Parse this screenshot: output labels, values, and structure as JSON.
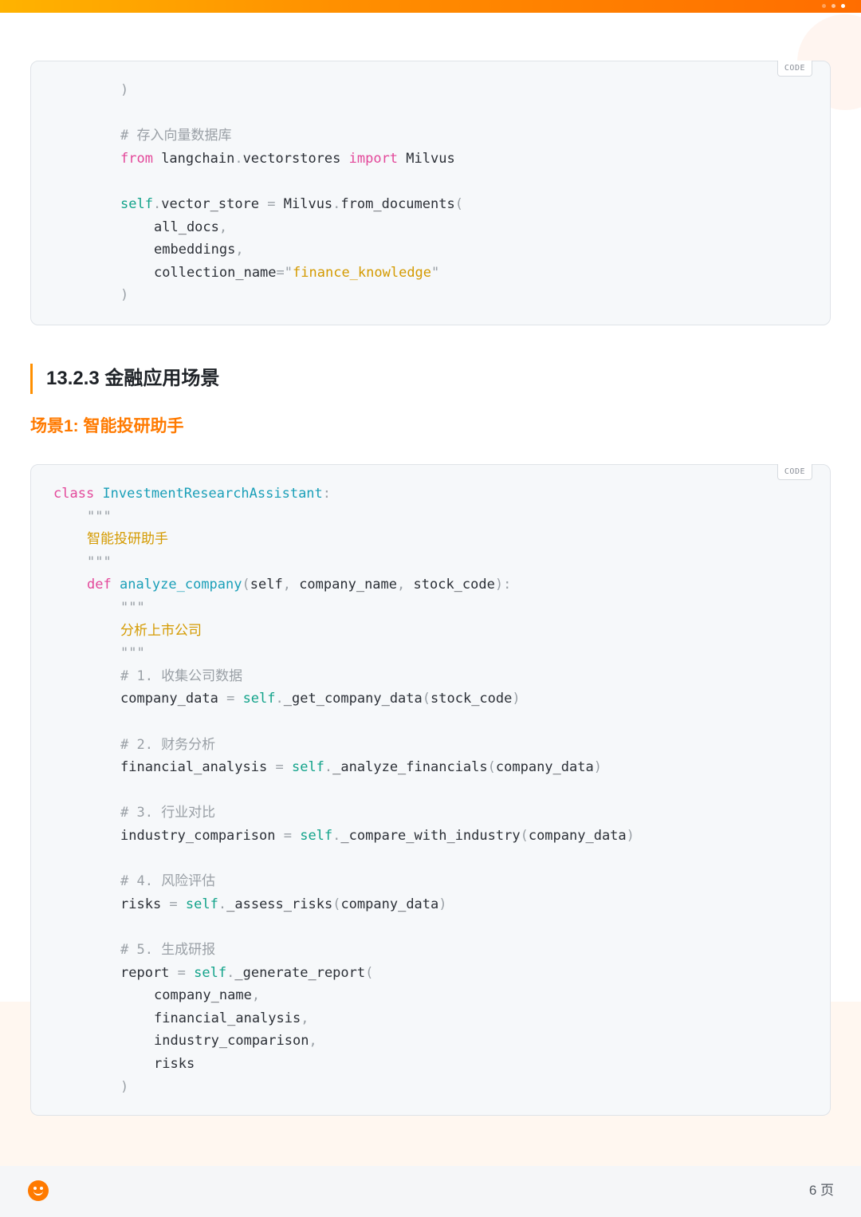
{
  "code_tag": "CODE",
  "code_block_1": {
    "lines": [
      {
        "indent": 2,
        "parts": [
          {
            "t": ")",
            "c": "pn"
          }
        ]
      },
      {
        "indent": 2,
        "parts": []
      },
      {
        "indent": 2,
        "parts": [
          {
            "t": "# ",
            "c": "cm"
          },
          {
            "t": "存入向量数据库",
            "c": "cm cjk-cm"
          }
        ]
      },
      {
        "indent": 2,
        "parts": [
          {
            "t": "from",
            "c": "kw"
          },
          {
            "t": " langchain",
            "c": ""
          },
          {
            "t": ".",
            "c": "pn"
          },
          {
            "t": "vectorstores ",
            "c": ""
          },
          {
            "t": "import",
            "c": "kw"
          },
          {
            "t": " Milvus",
            "c": ""
          }
        ]
      },
      {
        "indent": 2,
        "parts": []
      },
      {
        "indent": 2,
        "parts": [
          {
            "t": "self",
            "c": "sf"
          },
          {
            "t": ".",
            "c": "pn"
          },
          {
            "t": "vector_store ",
            "c": ""
          },
          {
            "t": "=",
            "c": "pn"
          },
          {
            "t": " Milvus",
            "c": ""
          },
          {
            "t": ".",
            "c": "pn"
          },
          {
            "t": "from_documents",
            "c": ""
          },
          {
            "t": "(",
            "c": "pn"
          }
        ]
      },
      {
        "indent": 3,
        "parts": [
          {
            "t": "all_docs",
            "c": ""
          },
          {
            "t": ",",
            "c": "pn"
          }
        ]
      },
      {
        "indent": 3,
        "parts": [
          {
            "t": "embeddings",
            "c": ""
          },
          {
            "t": ",",
            "c": "pn"
          }
        ]
      },
      {
        "indent": 3,
        "parts": [
          {
            "t": "collection_name",
            "c": ""
          },
          {
            "t": "=",
            "c": "pn"
          },
          {
            "t": "\"",
            "c": "pn"
          },
          {
            "t": "finance_knowledge",
            "c": "st"
          },
          {
            "t": "\"",
            "c": "pn"
          }
        ]
      },
      {
        "indent": 2,
        "parts": [
          {
            "t": ")",
            "c": "pn"
          }
        ]
      }
    ]
  },
  "section_heading": "13.2.3 金融应用场景",
  "scenario_heading": "场景1: 智能投研助手",
  "code_block_2": {
    "lines": [
      {
        "indent": 0,
        "parts": [
          {
            "t": "class",
            "c": "kw"
          },
          {
            "t": " ",
            "c": ""
          },
          {
            "t": "InvestmentResearchAssistant",
            "c": "fn"
          },
          {
            "t": ":",
            "c": "pn"
          }
        ]
      },
      {
        "indent": 1,
        "parts": [
          {
            "t": "\"\"\"",
            "c": "pn"
          }
        ]
      },
      {
        "indent": 1,
        "parts": [
          {
            "t": "智能投研助手",
            "c": "doc"
          }
        ]
      },
      {
        "indent": 1,
        "parts": [
          {
            "t": "\"\"\"",
            "c": "pn"
          }
        ]
      },
      {
        "indent": 1,
        "parts": [
          {
            "t": "def",
            "c": "kw"
          },
          {
            "t": " ",
            "c": ""
          },
          {
            "t": "analyze_company",
            "c": "fn"
          },
          {
            "t": "(",
            "c": "pn"
          },
          {
            "t": "self",
            "c": ""
          },
          {
            "t": ", ",
            "c": "pn"
          },
          {
            "t": "company_name",
            "c": ""
          },
          {
            "t": ", ",
            "c": "pn"
          },
          {
            "t": "stock_code",
            "c": ""
          },
          {
            "t": "):",
            "c": "pn"
          }
        ]
      },
      {
        "indent": 2,
        "parts": [
          {
            "t": "\"\"\"",
            "c": "pn"
          }
        ]
      },
      {
        "indent": 2,
        "parts": [
          {
            "t": "分析上市公司",
            "c": "doc"
          }
        ]
      },
      {
        "indent": 2,
        "parts": [
          {
            "t": "\"\"\"",
            "c": "pn"
          }
        ]
      },
      {
        "indent": 2,
        "parts": [
          {
            "t": "# 1. ",
            "c": "cm"
          },
          {
            "t": "收集公司数据",
            "c": "cm cjk-cm"
          }
        ]
      },
      {
        "indent": 2,
        "parts": [
          {
            "t": "company_data ",
            "c": ""
          },
          {
            "t": "=",
            "c": "pn"
          },
          {
            "t": " ",
            "c": ""
          },
          {
            "t": "self",
            "c": "sf"
          },
          {
            "t": ".",
            "c": "pn"
          },
          {
            "t": "_get_company_data",
            "c": ""
          },
          {
            "t": "(",
            "c": "pn"
          },
          {
            "t": "stock_code",
            "c": ""
          },
          {
            "t": ")",
            "c": "pn"
          }
        ]
      },
      {
        "indent": 2,
        "parts": []
      },
      {
        "indent": 2,
        "parts": [
          {
            "t": "# 2. ",
            "c": "cm"
          },
          {
            "t": "财务分析",
            "c": "cm cjk-cm"
          }
        ]
      },
      {
        "indent": 2,
        "parts": [
          {
            "t": "financial_analysis ",
            "c": ""
          },
          {
            "t": "=",
            "c": "pn"
          },
          {
            "t": " ",
            "c": ""
          },
          {
            "t": "self",
            "c": "sf"
          },
          {
            "t": ".",
            "c": "pn"
          },
          {
            "t": "_analyze_financials",
            "c": ""
          },
          {
            "t": "(",
            "c": "pn"
          },
          {
            "t": "company_data",
            "c": ""
          },
          {
            "t": ")",
            "c": "pn"
          }
        ]
      },
      {
        "indent": 2,
        "parts": []
      },
      {
        "indent": 2,
        "parts": [
          {
            "t": "# 3. ",
            "c": "cm"
          },
          {
            "t": "行业对比",
            "c": "cm cjk-cm"
          }
        ]
      },
      {
        "indent": 2,
        "parts": [
          {
            "t": "industry_comparison ",
            "c": ""
          },
          {
            "t": "=",
            "c": "pn"
          },
          {
            "t": " ",
            "c": ""
          },
          {
            "t": "self",
            "c": "sf"
          },
          {
            "t": ".",
            "c": "pn"
          },
          {
            "t": "_compare_with_industry",
            "c": ""
          },
          {
            "t": "(",
            "c": "pn"
          },
          {
            "t": "company_data",
            "c": ""
          },
          {
            "t": ")",
            "c": "pn"
          }
        ]
      },
      {
        "indent": 2,
        "parts": []
      },
      {
        "indent": 2,
        "parts": [
          {
            "t": "# 4. ",
            "c": "cm"
          },
          {
            "t": "风险评估",
            "c": "cm cjk-cm"
          }
        ]
      },
      {
        "indent": 2,
        "parts": [
          {
            "t": "risks ",
            "c": ""
          },
          {
            "t": "=",
            "c": "pn"
          },
          {
            "t": " ",
            "c": ""
          },
          {
            "t": "self",
            "c": "sf"
          },
          {
            "t": ".",
            "c": "pn"
          },
          {
            "t": "_assess_risks",
            "c": ""
          },
          {
            "t": "(",
            "c": "pn"
          },
          {
            "t": "company_data",
            "c": ""
          },
          {
            "t": ")",
            "c": "pn"
          }
        ]
      },
      {
        "indent": 2,
        "parts": []
      },
      {
        "indent": 2,
        "parts": [
          {
            "t": "# 5. ",
            "c": "cm"
          },
          {
            "t": "生成研报",
            "c": "cm cjk-cm"
          }
        ]
      },
      {
        "indent": 2,
        "parts": [
          {
            "t": "report ",
            "c": ""
          },
          {
            "t": "=",
            "c": "pn"
          },
          {
            "t": " ",
            "c": ""
          },
          {
            "t": "self",
            "c": "sf"
          },
          {
            "t": ".",
            "c": "pn"
          },
          {
            "t": "_generate_report",
            "c": ""
          },
          {
            "t": "(",
            "c": "pn"
          }
        ]
      },
      {
        "indent": 3,
        "parts": [
          {
            "t": "company_name",
            "c": ""
          },
          {
            "t": ",",
            "c": "pn"
          }
        ]
      },
      {
        "indent": 3,
        "parts": [
          {
            "t": "financial_analysis",
            "c": ""
          },
          {
            "t": ",",
            "c": "pn"
          }
        ]
      },
      {
        "indent": 3,
        "parts": [
          {
            "t": "industry_comparison",
            "c": ""
          },
          {
            "t": ",",
            "c": "pn"
          }
        ]
      },
      {
        "indent": 3,
        "parts": [
          {
            "t": "risks",
            "c": ""
          }
        ]
      },
      {
        "indent": 2,
        "parts": [
          {
            "t": ")",
            "c": "pn"
          }
        ]
      }
    ]
  },
  "footer": {
    "page_label": "6 页",
    "logo_icon": "smiley-logo-icon"
  },
  "colors": {
    "accent": "#ff7a00",
    "keyword": "#e3489a",
    "function": "#1a9fb8",
    "self": "#12a38a",
    "string": "#d49a00",
    "comment": "#9aa0a6"
  }
}
